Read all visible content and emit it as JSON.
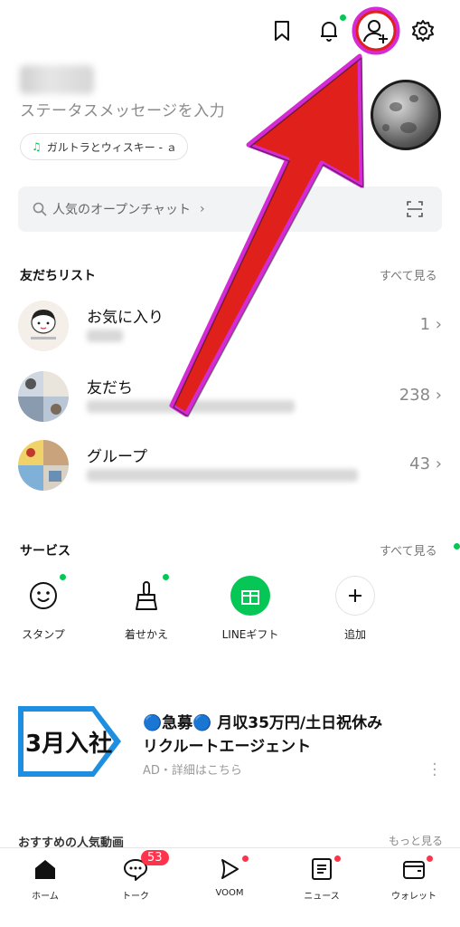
{
  "header": {
    "status_message": "ステータスメッセージを入力",
    "music": "ガルトラとウィスキー - ａ"
  },
  "search": {
    "placeholder": "人気のオープンチャット"
  },
  "friends_section": {
    "title": "友だちリスト",
    "see_all": "すべて見る",
    "rows": [
      {
        "title": "お気に入り",
        "count": "1"
      },
      {
        "title": "友だち",
        "count": "238"
      },
      {
        "title": "グループ",
        "count": "43"
      }
    ]
  },
  "services_section": {
    "title": "サービス",
    "see_all": "すべて見る",
    "items": [
      {
        "label": "スタンプ"
      },
      {
        "label": "着せかえ"
      },
      {
        "label": "LINEギフト"
      },
      {
        "label": "追加"
      }
    ]
  },
  "ad": {
    "banner_text": "3月入社",
    "title_line1": "🔵急募🔵 月収35万円/土日祝休み",
    "title_line2": "リクルートエージェント",
    "sub": "AD・詳細はこちら"
  },
  "next_section": {
    "title": "おすすめの人気動画",
    "more": "もっと見る"
  },
  "tabbar": {
    "tabs": [
      {
        "label": "ホーム"
      },
      {
        "label": "トーク",
        "badge": "53"
      },
      {
        "label": "VOOM"
      },
      {
        "label": "ニュース"
      },
      {
        "label": "ウォレット"
      }
    ]
  },
  "colors": {
    "accent_green": "#06c755",
    "badge_red": "#ff334b",
    "annotation_red": "#e0201b",
    "annotation_magenta": "#d52bd5"
  },
  "icons": [
    "bookmark-icon",
    "bell-icon",
    "add-friend-icon",
    "gear-icon",
    "search-icon",
    "scan-icon",
    "smile-icon",
    "brush-icon",
    "gift-icon",
    "plus-icon",
    "home-icon",
    "talk-icon",
    "voom-icon",
    "news-icon",
    "wallet-icon"
  ]
}
